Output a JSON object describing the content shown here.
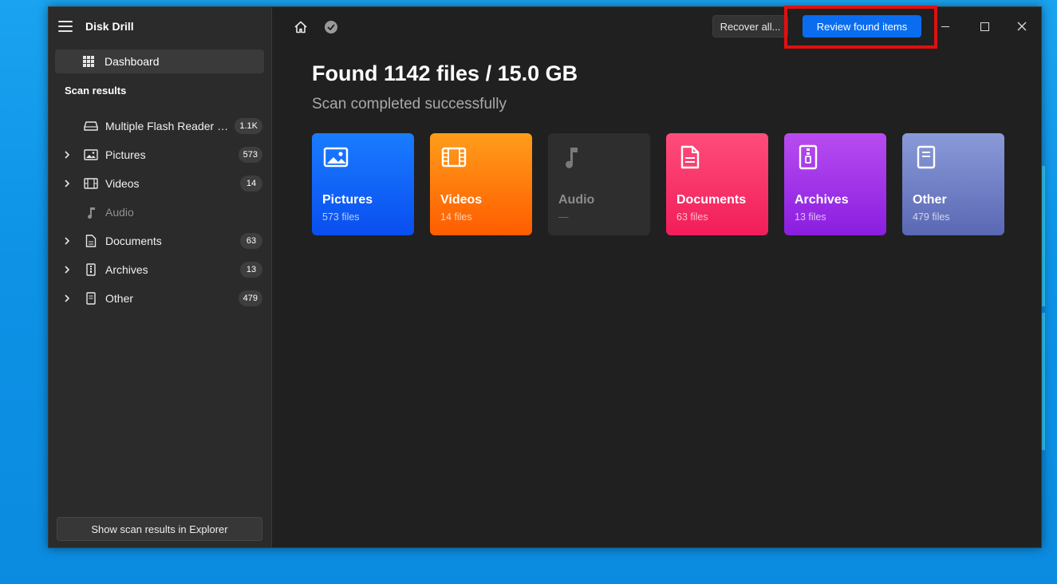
{
  "app": {
    "title": "Disk Drill"
  },
  "sidebar": {
    "dashboard_label": "Dashboard",
    "section_label": "Scan results",
    "items": [
      {
        "label": "Multiple Flash Reader U...",
        "count": "1.1K",
        "icon": "drive-icon",
        "expandable": false
      },
      {
        "label": "Pictures",
        "count": "573",
        "icon": "picture-icon",
        "expandable": true
      },
      {
        "label": "Videos",
        "count": "14",
        "icon": "film-icon",
        "expandable": true
      },
      {
        "label": "Audio",
        "count": "",
        "icon": "music-note-icon",
        "expandable": false,
        "disabled": true
      },
      {
        "label": "Documents",
        "count": "63",
        "icon": "document-icon",
        "expandable": true
      },
      {
        "label": "Archives",
        "count": "13",
        "icon": "archive-icon",
        "expandable": true
      },
      {
        "label": "Other",
        "count": "479",
        "icon": "file-icon",
        "expandable": true
      }
    ],
    "explorer_button": "Show scan results in Explorer"
  },
  "toolbar": {
    "recover_all_label": "Recover all...",
    "review_label": "Review found items"
  },
  "main": {
    "headline": "Found 1142 files / 15.0 GB",
    "subheadline": "Scan completed successfully",
    "cards": [
      {
        "name": "Pictures",
        "count": "573 files"
      },
      {
        "name": "Videos",
        "count": "14 files"
      },
      {
        "name": "Audio",
        "count": "—"
      },
      {
        "name": "Documents",
        "count": "63 files"
      },
      {
        "name": "Archives",
        "count": "13 files"
      },
      {
        "name": "Other",
        "count": "479 files"
      }
    ]
  },
  "colors": {
    "accent": "#0a6df0",
    "highlight": "#e01010",
    "pictures": "#1a7cff",
    "videos": "#ff7a00",
    "documents": "#f7346a",
    "archives": "#a236ea",
    "other": "#7382c8"
  }
}
